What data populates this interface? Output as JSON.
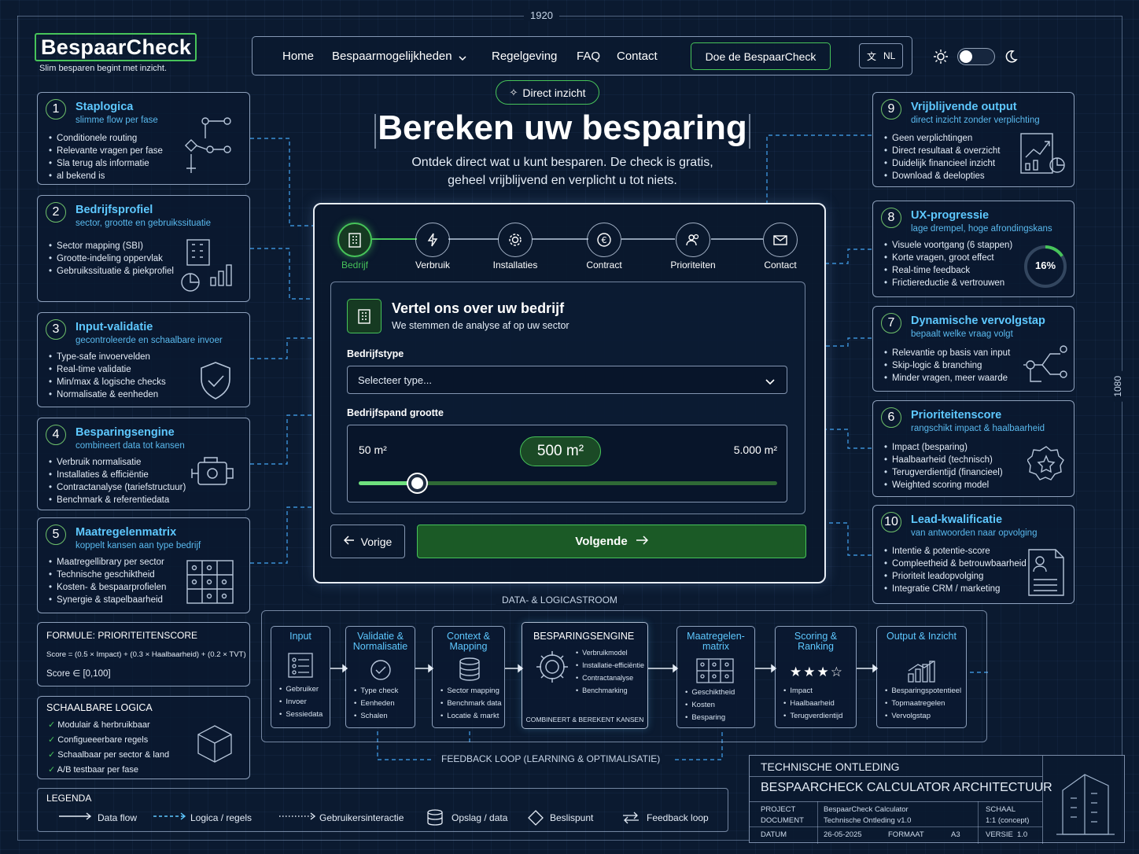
{
  "frame": {
    "width_label": "1920",
    "height_label": "1080"
  },
  "brand": {
    "name": "BespaarCheck",
    "tagline": "Slim besparen begint met inzicht."
  },
  "nav": {
    "items": [
      "Home",
      "Bespaarmogelijkheden",
      "Regelgeving",
      "FAQ",
      "Contact"
    ],
    "cta": "Doe de BespaarCheck",
    "lang": "NL"
  },
  "hero": {
    "badge": "Direct inzicht",
    "title": "Bereken uw besparing",
    "subtitle_line1": "Ontdek direct wat u kunt besparen. De check is gratis,",
    "subtitle_line2": "geheel vrijblijvend en verplicht u tot niets."
  },
  "wizard": {
    "steps": [
      "Bedrijf",
      "Verbruik",
      "Installaties",
      "Contract",
      "Prioriteiten",
      "Contact"
    ],
    "active_step": 0,
    "card_title": "Vertel ons over uw bedrijf",
    "card_subtitle": "We stemmen de analyse af op uw sector",
    "type_label": "Bedrijfstype",
    "type_placeholder": "Selecteer type...",
    "size_label": "Bedrijfspand grootte",
    "size_min": "50 m²",
    "size_max": "5.000 m²",
    "size_value": "500 m²",
    "slider_fraction": 0.14,
    "prev": "Vorige",
    "next": "Volgende"
  },
  "left_panels": [
    {
      "num": "1",
      "title": "Staplogica",
      "subtitle": "slimme flow per fase",
      "bullets": [
        "Conditionele routing",
        "Relevante vragen per fase",
        "Sla terug als informatie",
        "al bekend is"
      ],
      "icon": "flow-nodes-icon"
    },
    {
      "num": "2",
      "title": "Bedrijfsprofiel",
      "subtitle": "sector, grootte en gebruikssituatie",
      "bullets": [
        "Sector mapping (SBI)",
        "Grootte-indeling oppervlak",
        "Gebruikssituatie & piekprofiel"
      ],
      "icon": "building-chart-icon"
    },
    {
      "num": "3",
      "title": "Input-validatie",
      "subtitle": "gecontroleerde en schaalbare invoer",
      "bullets": [
        "Type-safe invoervelden",
        "Real-time validatie",
        "Min/max & logische checks",
        "Normalisatie & eenheden"
      ],
      "icon": "shield-check-icon"
    },
    {
      "num": "4",
      "title": "Besparingsengine",
      "subtitle": "combineert data tot kansen",
      "bullets": [
        "Verbruik normalisatie",
        "Installaties & efficiëntie",
        "Contractanalyse (tariefstructuur)",
        "Benchmark & referentiedata"
      ],
      "icon": "engine-icon"
    },
    {
      "num": "5",
      "title": "Maatregelenmatrix",
      "subtitle": "koppelt kansen aan type bedrijf",
      "bullets": [
        "Maatregellibrary per sector",
        "Technische geschiktheid",
        "Kosten- & bespaarprofielen",
        "Synergie & stapelbaarheid"
      ],
      "icon": "matrix-icon"
    }
  ],
  "formula": {
    "title": "FORMULE:  PRIORITEITENSCORE",
    "line1": "Score = (0.5 × Impact) + (0.3 × Haalbaarheid) + (0.2 × TVT)",
    "line2": "Score  ∈  [0,100]"
  },
  "scalable": {
    "title": "SCHAALBARE LOGICA",
    "items": [
      "Modulair & herbruikbaar",
      "Configueeerbare regels",
      "Schaalbaar per sector & land",
      "A/B testbaar per fase"
    ]
  },
  "right_panels": [
    {
      "num": "9",
      "title": "Vrijblijvende output",
      "subtitle": "direct inzicht zonder verplichting",
      "bullets": [
        "Geen verplichtingen",
        "Direct resultaat & overzicht",
        "Duidelijk financieel inzicht",
        "Download & deelopties"
      ],
      "icon": "report-chart-icon"
    },
    {
      "num": "8",
      "title": "UX-progressie",
      "subtitle": "lage drempel, hoge afrondingskans",
      "bullets": [
        "Visuele voortgang (6 stappen)",
        "Korte vragen, groot effect",
        "Real-time feedback",
        "Frictiereductie & vertrouwen"
      ],
      "progress_label": "16%",
      "progress": 0.16
    },
    {
      "num": "7",
      "title": "Dynamische vervolgstap",
      "subtitle": "bepaalt welke vraag volgt",
      "bullets": [
        "Relevantie op basis van input",
        "Skip-logic & branching",
        "Minder vragen, meer waarde"
      ],
      "icon": "branch-icon"
    },
    {
      "num": "6",
      "title": "Prioriteitenscore",
      "subtitle": "rangschikt impact & haalbaarheid",
      "bullets": [
        "Impact (besparing)",
        "Haalbaarheid (technisch)",
        "Terugverdientijd (financieel)",
        "Weighted scoring model"
      ],
      "icon": "star-badge-icon"
    },
    {
      "num": "10",
      "title": "Lead-kwalificatie",
      "subtitle": "van antwoorden naar opvolging",
      "bullets": [
        "Intentie & potentie-score",
        "Compleetheid & betrouwbaarheid",
        "Prioriteit leadopvolging",
        "Integratie CRM / marketing"
      ],
      "icon": "profile-doc-icon"
    }
  ],
  "pipeline": {
    "title": "DATA-  &  LOGICASTROOM",
    "stages": [
      {
        "title": "Input",
        "items": [
          "Gebruiker",
          "Invoer",
          "Sessiedata"
        ]
      },
      {
        "title": "Validatie & Normalisatie",
        "items": [
          "Type check",
          "Eenheden",
          "Schalen"
        ]
      },
      {
        "title": "Context & Mapping",
        "items": [
          "Sector mapping",
          "Benchmark data",
          "Locatie & markt"
        ]
      },
      {
        "title": "BESPARINGSENGINE",
        "items": [
          "Verbruikmodel",
          "Installatie-efficiëntie",
          "Contractanalyse",
          "Benchmarking"
        ],
        "footer": "COMBINEERT  &  BEREKENT  KANSEN"
      },
      {
        "title": "Maatregelen-matrix",
        "items": [
          "Geschiktheid",
          "Kosten",
          "Besparing"
        ]
      },
      {
        "title": "Scoring & Ranking",
        "items": [
          "Impact",
          "Haalbaarheid",
          "Terugverdientijd"
        ]
      },
      {
        "title": "Output & Inzicht",
        "items": [
          "Besparingspotentieel",
          "Topmaatregelen",
          "Vervolgstap"
        ]
      }
    ],
    "feedback": "FEEDBACK  LOOP  (LEARNING  &  OPTIMALISATIE)"
  },
  "legend": {
    "title": "LEGENDA",
    "items": [
      "Data flow",
      "Logica / regels",
      "Gebruikersinteractie",
      "Opslag / data",
      "Beslispunt",
      "Feedback loop"
    ]
  },
  "titleblock": {
    "line1": "TECHNISCHE  ONTLEDING",
    "line2": "BESPAARCHECK  CALCULATOR  ARCHITECTUUR",
    "project_label": "PROJECT",
    "project_value": "BespaarCheck Calculator",
    "document_label": "DOCUMENT",
    "document_value": "Technische Ontleding v1.0",
    "datum_label": "DATUM",
    "datum_value": "26-05-2025",
    "formaat_label": "FORMAAT",
    "formaat_value": "A3",
    "schaal_label": "SCHAAL",
    "schaal_value": "1:1 (concept)",
    "versie_label": "VERSIE",
    "versie_value": "1.0"
  },
  "colors": {
    "accent_green": "#47c45a",
    "accent_cyan": "#5ec8ff",
    "background": "#0b1a30"
  }
}
